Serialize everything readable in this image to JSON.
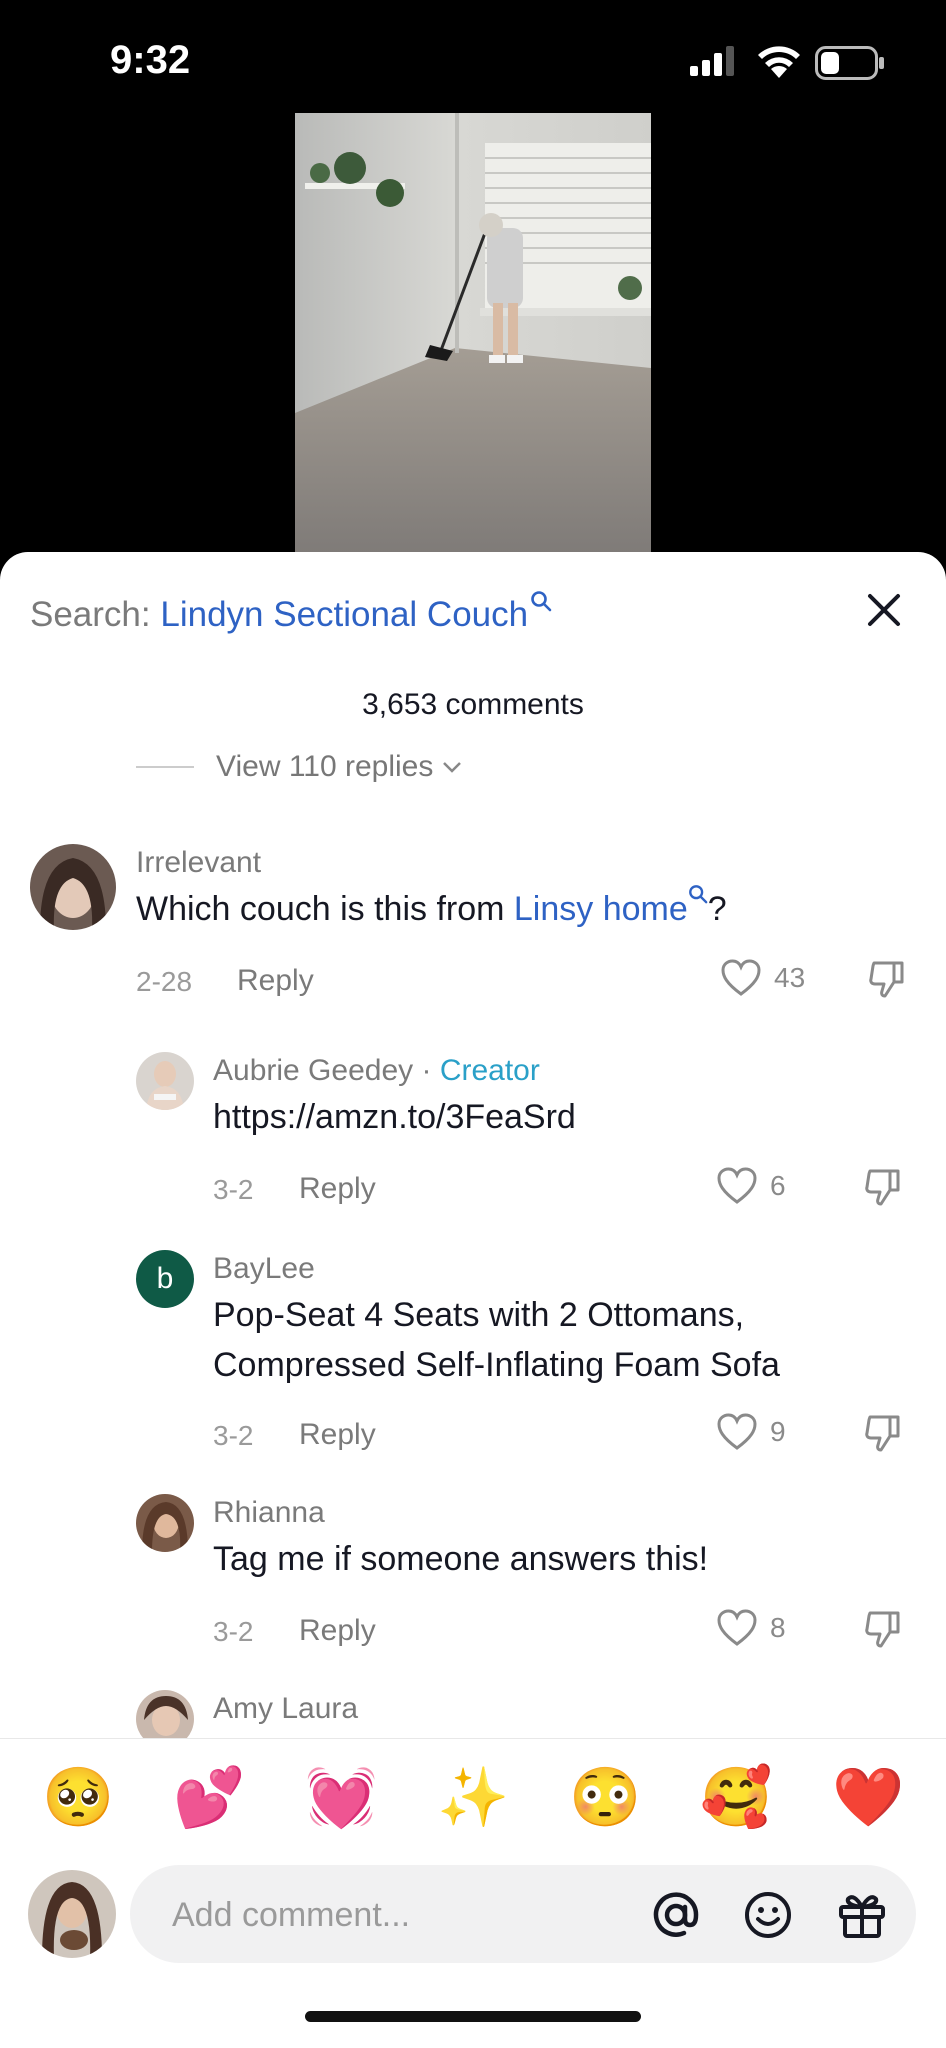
{
  "status": {
    "time": "9:32"
  },
  "search": {
    "prefix": "Search:",
    "query": "Lindyn Sectional Couch"
  },
  "comments_count": "3,653 comments",
  "view_replies": "View 110 replies",
  "comments": [
    {
      "user": "Irrelevant",
      "text_before": "Which couch is this from ",
      "text_link": "Linsy home",
      "text_after": "?",
      "date": "2-28",
      "reply": "Reply",
      "likes": "43"
    },
    {
      "user": "Aubrie Geedey",
      "sep": " · ",
      "badge": "Creator",
      "text": "https://amzn.to/3FeaSrd",
      "date": "3-2",
      "reply": "Reply",
      "likes": "6"
    },
    {
      "user": "BayLee",
      "avatar_letter": "b",
      "text_line1": "Pop-Seat 4 Seats with 2 Ottomans,",
      "text_line2": "Compressed Self-Inflating Foam Sofa",
      "date": "3-2",
      "reply": "Reply",
      "likes": "9"
    },
    {
      "user": "Rhianna",
      "text": "Tag me if someone answers this!",
      "date": "3-2",
      "reply": "Reply",
      "likes": "8"
    },
    {
      "user": "Amy Laura"
    }
  ],
  "emojis": [
    "🥺",
    "💕",
    "💓",
    "✨",
    "😳",
    "🥰",
    "❤️"
  ],
  "composer": {
    "placeholder": "Add comment..."
  },
  "colors": {
    "link": "#2e62c4",
    "creator_badge": "#2aa0c8",
    "baylee_avatar": "#0f5a46"
  }
}
